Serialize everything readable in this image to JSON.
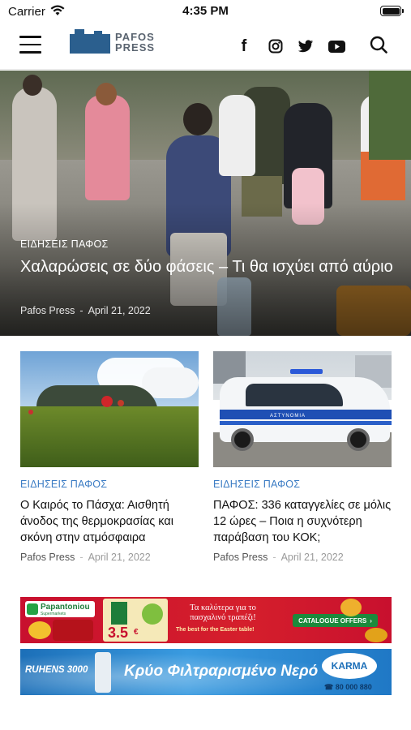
{
  "status_bar": {
    "carrier": "Carrier",
    "time": "4:35 PM"
  },
  "header": {
    "logo_line1": "PAFOS",
    "logo_line2": "PRESS",
    "social": [
      "facebook-icon",
      "instagram-icon",
      "twitter-icon",
      "youtube-icon"
    ],
    "search": "search-icon"
  },
  "hero": {
    "category": "ΕΙΔΗΣΕΙΣ ΠΑΦΟΣ",
    "title": "Χαλαρώσεις σε δύο φάσεις – Τι θα ισχύει από αύριο",
    "author": "Pafos Press",
    "separator": "-",
    "date": "April 21, 2022"
  },
  "articles": [
    {
      "category": "ΕΙΔΗΣΕΙΣ ΠΑΦΟΣ",
      "title": "Ο Καιρός το Πάσχα: Αισθητή άνοδος της θερμοκρασίας και σκόνη στην ατμόσφαιρα",
      "author": "Pafos Press",
      "separator": "-",
      "date": "April 21, 2022"
    },
    {
      "category": "ΕΙΔΗΣΕΙΣ ΠΑΦΟΣ",
      "title": "ΠΑΦΟΣ: 336 καταγγελίες σε μόλις 12 ώρες – Ποια η συχνότερη παράβαση του ΚΟΚ;",
      "author": "Pafos Press",
      "separator": "-",
      "date": "April 21, 2022",
      "image_text": "ΑΣΤΥΝΟΜΙΑ"
    }
  ],
  "ads": [
    {
      "brand": "Papantoniou",
      "brand_sub": "Supermarkets",
      "headline": "Τα καλύτερα για το πασχαλινό τραπέζι!",
      "subline": "The best for the Easter table!",
      "cta": "CATALOGUE OFFERS",
      "badge": "3.5",
      "badge_sub": "€"
    },
    {
      "brand": "RUHENS 3000",
      "headline": "Κρύο Φιλτραρισμένο Νερό",
      "logo": "KARMA",
      "phone": "80 000 880"
    }
  ],
  "colors": {
    "accent_blue": "#3b7cc4",
    "logo_blue": "#2b5f8e",
    "ad_red": "#c8102e",
    "ad_blue": "#1c6fb8"
  }
}
